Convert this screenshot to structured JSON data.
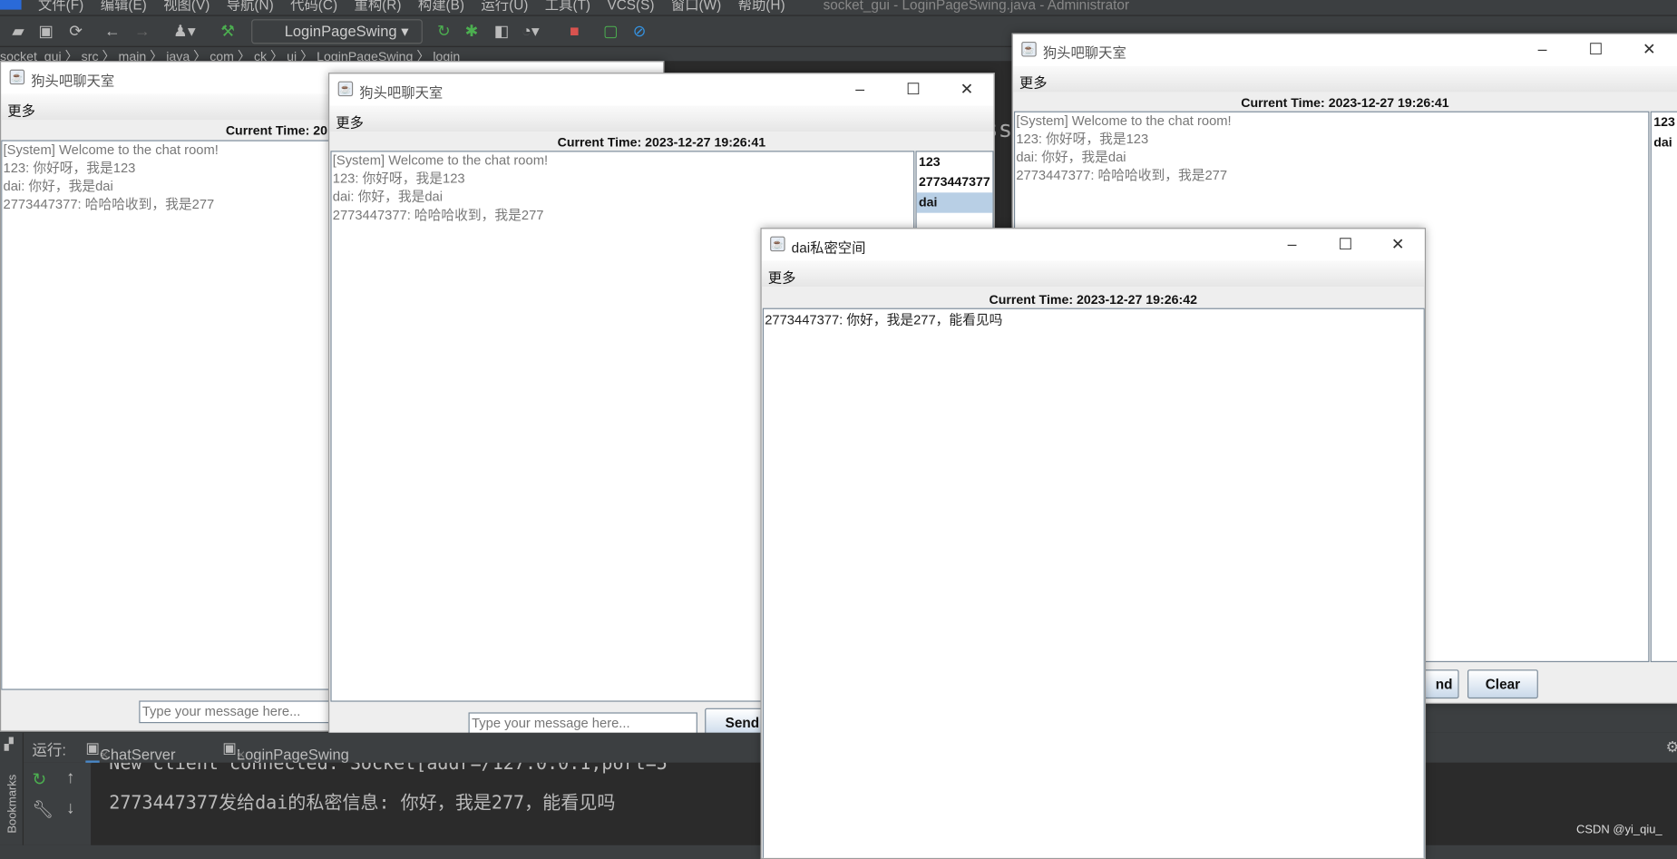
{
  "ide": {
    "menu": [
      "文件(F)",
      "编辑(E)",
      "视图(V)",
      "导航(N)",
      "代码(C)",
      "重构(R)",
      "构建(B)",
      "运行(U)",
      "工具(T)",
      "VCS(S)",
      "窗口(W)",
      "帮助(H)"
    ],
    "title": "socket_gui - LoginPageSwing.java - Administrator",
    "run_config": "LoginPageSwing",
    "breadcrumb": "socket_gui 〉 src 〉 main 〉 java 〉 com 〉 ck 〉 ui 〉 LoginPageSwing 〉 login",
    "editor_fragment": "ss",
    "run_label": "运行:",
    "run_tabs": [
      "ChatServer",
      "LoginPageSwing"
    ],
    "bookmarks_label": "Bookmarks",
    "console": [
      "New client connected: Socket[addr=/127.0.0.1,port=5",
      "2773447377发给dai的私密信息: 你好，我是277，能看见吗"
    ],
    "watermark": "CSDN @yi_qiu_"
  },
  "chat": {
    "title": "狗头吧聊天室",
    "menu": "更多",
    "time": "Current Time: 2023-12-27 19:26:41",
    "time_clipped": "Current Time: 20",
    "messages": [
      "[System] Welcome to the chat room!",
      "123: 你好呀，我是123",
      "dai: 你好，我是dai",
      "2773447377: 哈哈哈收到，我是277"
    ],
    "users": [
      "123",
      "2773447377",
      "dai"
    ],
    "users_right": [
      "123",
      "dai"
    ],
    "placeholder": "Type your message here...",
    "send": "Send",
    "send_clipped": "nd",
    "clear": "Clear"
  },
  "private": {
    "title": "dai私密空间",
    "menu": "更多",
    "time": "Current Time: 2023-12-27 19:26:42",
    "messages": [
      "2773447377: 你好，我是277，能看见吗"
    ]
  },
  "colors": {
    "ide_bg": "#3c3f41",
    "console_bg": "#2b2b2b",
    "selection": "#b8cfe5"
  }
}
